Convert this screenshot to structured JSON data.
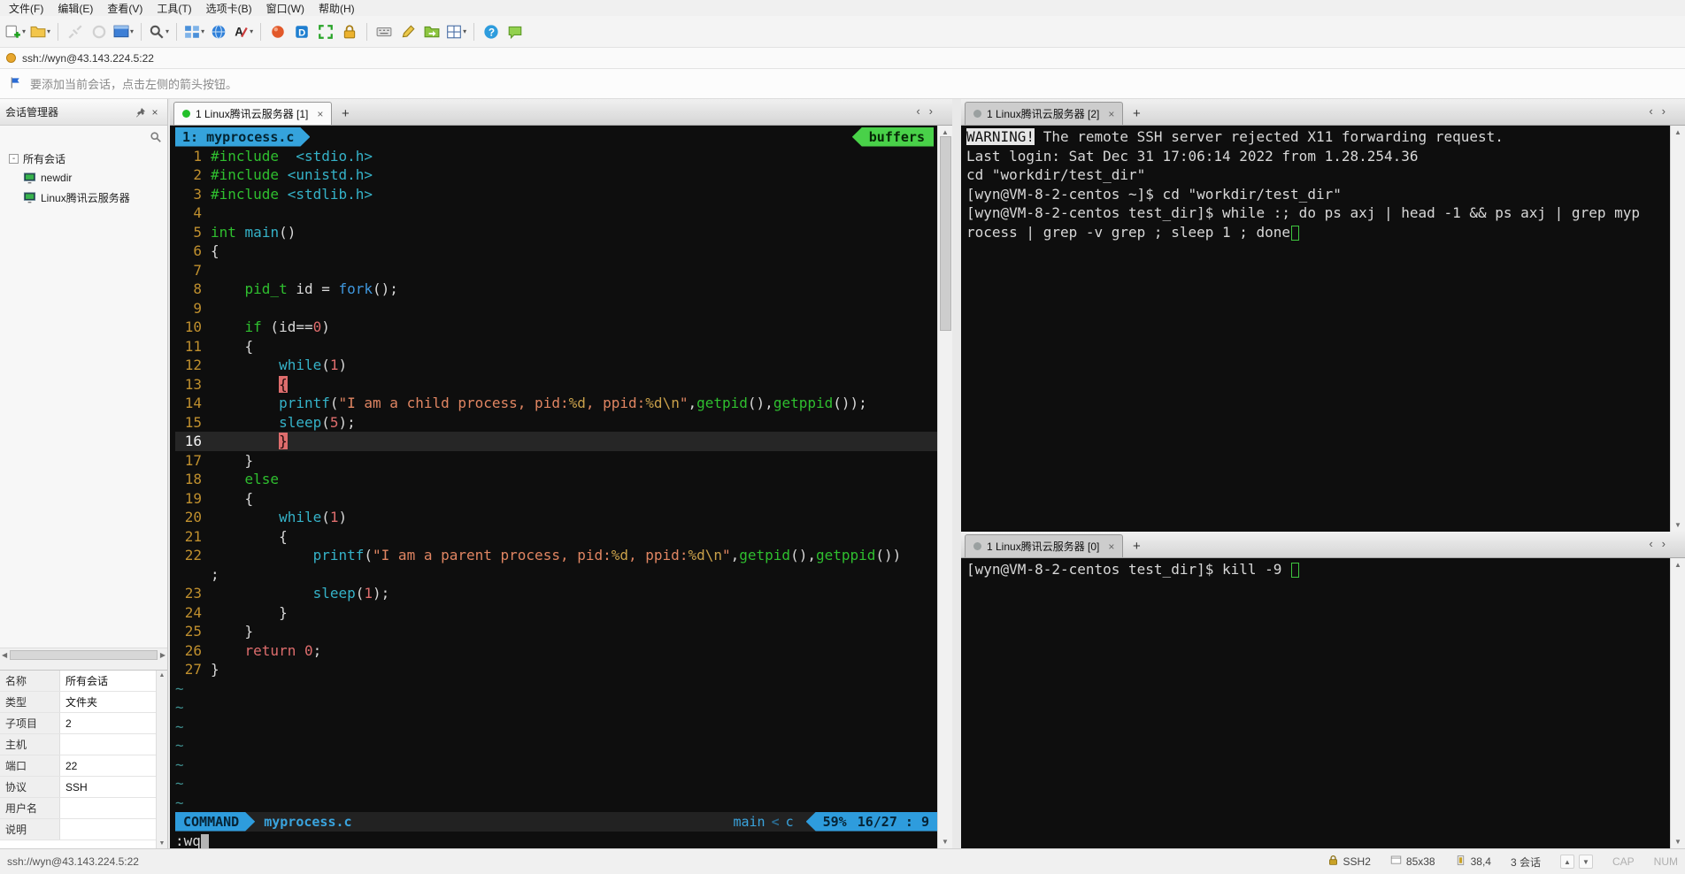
{
  "menu_bar": {
    "items": [
      "文件(F)",
      "编辑(E)",
      "查看(V)",
      "工具(T)",
      "选项卡(B)",
      "窗口(W)",
      "帮助(H)"
    ]
  },
  "toolbar": {
    "items": [
      {
        "icon": "new-session-icon",
        "dropdown": true
      },
      {
        "icon": "open-folder-icon",
        "dropdown": true
      },
      {
        "sep": true
      },
      {
        "icon": "disconnect-icon",
        "disabled": true
      },
      {
        "icon": "reconnect-icon",
        "disabled": true
      },
      {
        "icon": "new-window-icon",
        "dropdown": true
      },
      {
        "sep": true
      },
      {
        "icon": "find-icon",
        "dropdown": true
      },
      {
        "sep": true
      },
      {
        "icon": "layout-icon",
        "dropdown": true
      },
      {
        "icon": "web-icon"
      },
      {
        "icon": "font-color-icon",
        "dropdown": true
      },
      {
        "sep": true
      },
      {
        "icon": "proxy-icon"
      },
      {
        "icon": "xagent-icon"
      },
      {
        "icon": "fullscreen-icon"
      },
      {
        "icon": "lock-icon"
      },
      {
        "sep": true
      },
      {
        "icon": "keyboard-icon"
      },
      {
        "icon": "compose-icon"
      },
      {
        "icon": "xftp-icon"
      },
      {
        "icon": "tile-windows-icon",
        "dropdown": true
      },
      {
        "sep": true
      },
      {
        "icon": "help-icon"
      },
      {
        "icon": "chat-icon"
      }
    ]
  },
  "address_bar": {
    "value": "ssh://wyn@43.143.224.5:22"
  },
  "info_bar": {
    "text": "要添加当前会话，点击左侧的箭头按钮。"
  },
  "session_manager": {
    "title": "会话管理器",
    "tree": [
      {
        "label": "所有会话",
        "type": "folder",
        "level": 0
      },
      {
        "label": "newdir",
        "type": "session",
        "level": 1
      },
      {
        "label": "Linux腾讯云服务器",
        "type": "session",
        "level": 1
      }
    ],
    "properties": [
      {
        "label": "名称",
        "value": "所有会话"
      },
      {
        "label": "类型",
        "value": "文件夹"
      },
      {
        "label": "子项目",
        "value": "2"
      },
      {
        "label": "主机",
        "value": ""
      },
      {
        "label": "端口",
        "value": "22"
      },
      {
        "label": "协议",
        "value": "SSH"
      },
      {
        "label": "用户名",
        "value": ""
      },
      {
        "label": "说明",
        "value": ""
      }
    ]
  },
  "panes": {
    "editor": {
      "tab": {
        "label": "1 Linux腾讯云服务器 [1]",
        "dot_color": "#23c02a"
      },
      "buffer_bar": {
        "left": "1: myprocess.c",
        "right": "buffers"
      },
      "lines": [
        {
          "num": "1",
          "segs": [
            [
              "k",
              "#include"
            ],
            [
              "n",
              "  "
            ],
            [
              "c",
              "<stdio.h>"
            ]
          ]
        },
        {
          "num": "2",
          "segs": [
            [
              "k",
              "#include"
            ],
            [
              "n",
              " "
            ],
            [
              "c",
              "<unistd.h>"
            ]
          ]
        },
        {
          "num": "3",
          "segs": [
            [
              "k",
              "#include"
            ],
            [
              "n",
              " "
            ],
            [
              "c",
              "<stdlib.h>"
            ]
          ]
        },
        {
          "num": "4",
          "segs": []
        },
        {
          "num": "5",
          "segs": [
            [
              "k",
              "int"
            ],
            [
              "n",
              " "
            ],
            [
              "c",
              "main"
            ],
            [
              "n",
              "()"
            ]
          ]
        },
        {
          "num": "6",
          "segs": [
            [
              "n",
              "{"
            ]
          ]
        },
        {
          "num": "7",
          "segs": []
        },
        {
          "num": "8",
          "segs": [
            [
              "n",
              "    "
            ],
            [
              "k",
              "pid_t"
            ],
            [
              "n",
              " id = "
            ],
            [
              "b",
              "fork"
            ],
            [
              "n",
              "();"
            ]
          ]
        },
        {
          "num": "9",
          "segs": []
        },
        {
          "num": "10",
          "segs": [
            [
              "n",
              "    "
            ],
            [
              "k",
              "if"
            ],
            [
              "n",
              " (id=="
            ],
            [
              "r",
              "0"
            ],
            [
              "n",
              ")"
            ]
          ]
        },
        {
          "num": "11",
          "segs": [
            [
              "n",
              "    {"
            ]
          ]
        },
        {
          "num": "12",
          "segs": [
            [
              "n",
              "        "
            ],
            [
              "c",
              "while"
            ],
            [
              "n",
              "("
            ],
            [
              "r",
              "1"
            ],
            [
              "n",
              ")"
            ]
          ]
        },
        {
          "num": "13",
          "segs": [
            [
              "n",
              "        "
            ],
            [
              "mp",
              "{"
            ]
          ]
        },
        {
          "num": "14",
          "segs": [
            [
              "n",
              "        "
            ],
            [
              "c",
              "printf"
            ],
            [
              "n",
              "("
            ],
            [
              "s",
              "\"I am a child process, pid:"
            ],
            [
              "sp",
              "%d"
            ],
            [
              "s",
              ", ppid:"
            ],
            [
              "sp",
              "%d"
            ],
            [
              "sp",
              "\\n"
            ],
            [
              "s",
              "\""
            ],
            [
              "n",
              ","
            ],
            [
              "g",
              "getpid"
            ],
            [
              "n",
              "(),"
            ],
            [
              "g",
              "getppid"
            ],
            [
              "n",
              "());"
            ]
          ]
        },
        {
          "num": "15",
          "segs": [
            [
              "n",
              "        "
            ],
            [
              "c",
              "sleep"
            ],
            [
              "n",
              "("
            ],
            [
              "r",
              "5"
            ],
            [
              "n",
              ");"
            ]
          ]
        },
        {
          "num": "16",
          "cursor_line": true,
          "segs": [
            [
              "n",
              "        "
            ],
            [
              "mp",
              "}"
            ]
          ]
        },
        {
          "num": "17",
          "segs": [
            [
              "n",
              "    }"
            ]
          ]
        },
        {
          "num": "18",
          "segs": [
            [
              "n",
              "    "
            ],
            [
              "k",
              "else"
            ]
          ]
        },
        {
          "num": "19",
          "segs": [
            [
              "n",
              "    {"
            ]
          ]
        },
        {
          "num": "20",
          "segs": [
            [
              "n",
              "        "
            ],
            [
              "c",
              "while"
            ],
            [
              "n",
              "("
            ],
            [
              "r",
              "1"
            ],
            [
              "n",
              ")"
            ]
          ]
        },
        {
          "num": "21",
          "segs": [
            [
              "n",
              "        {"
            ]
          ]
        },
        {
          "num": "22",
          "segs": [
            [
              "n",
              "            "
            ],
            [
              "c",
              "printf"
            ],
            [
              "n",
              "("
            ],
            [
              "s",
              "\"I am a parent process, pid:"
            ],
            [
              "sp",
              "%d"
            ],
            [
              "s",
              ", ppid:"
            ],
            [
              "sp",
              "%d"
            ],
            [
              "sp",
              "\\n"
            ],
            [
              "s",
              "\""
            ],
            [
              "n",
              ","
            ],
            [
              "g",
              "getpid"
            ],
            [
              "n",
              "(),"
            ],
            [
              "g",
              "getppid"
            ],
            [
              "n",
              "())"
            ]
          ]
        },
        {
          "num": "",
          "segs": [
            [
              "n",
              ";"
            ]
          ]
        },
        {
          "num": "23",
          "segs": [
            [
              "n",
              "            "
            ],
            [
              "c",
              "sleep"
            ],
            [
              "n",
              "("
            ],
            [
              "r",
              "1"
            ],
            [
              "n",
              ");"
            ]
          ]
        },
        {
          "num": "24",
          "segs": [
            [
              "n",
              "        }"
            ]
          ]
        },
        {
          "num": "25",
          "segs": [
            [
              "n",
              "    }"
            ]
          ]
        },
        {
          "num": "26",
          "segs": [
            [
              "n",
              "    "
            ],
            [
              "r",
              "return"
            ],
            [
              "n",
              " "
            ],
            [
              "r",
              "0"
            ],
            [
              "n",
              ";"
            ]
          ]
        },
        {
          "num": "27",
          "segs": [
            [
              "n",
              "}"
            ]
          ]
        }
      ],
      "filler": "~",
      "filler_count": 7,
      "statusline": {
        "mode": "COMMAND",
        "file": "myprocess.c",
        "context": "main",
        "separator": "<",
        "filetype": "c",
        "percent": "59%",
        "position": "16/27 :  9"
      },
      "command_line": ":wq"
    },
    "top_right": {
      "tab": {
        "label": "1 Linux腾讯云服务器 [2]",
        "dot_color": "#9aa0a0"
      },
      "lines": [
        {
          "segs": [
            [
              "inv",
              "WARNING!"
            ],
            [
              "t",
              " The remote SSH server rejected X11 forwarding request."
            ]
          ]
        },
        {
          "segs": [
            [
              "t",
              "Last login: Sat Dec 31 17:06:14 2022 from 1.28.254.36"
            ]
          ]
        },
        {
          "segs": [
            [
              "t",
              "cd \"workdir/test_dir\""
            ]
          ]
        },
        {
          "segs": [
            [
              "t",
              "[wyn@VM-8-2-centos ~]$ cd \"workdir/test_dir\""
            ]
          ]
        },
        {
          "segs": [
            [
              "t",
              "[wyn@VM-8-2-centos test_dir]$ while :; do ps axj | head -1 && ps axj | grep myp"
            ]
          ]
        },
        {
          "segs": [
            [
              "t",
              "rocess | grep -v grep ; sleep 1 ; done"
            ],
            [
              "cb",
              " "
            ]
          ]
        }
      ]
    },
    "bottom_right": {
      "tab": {
        "label": "1 Linux腾讯云服务器 [0]",
        "dot_color": "#9aa0a0"
      },
      "lines": [
        {
          "segs": [
            [
              "t",
              "[wyn@VM-8-2-centos test_dir]$ kill -9 "
            ],
            [
              "cb",
              " "
            ]
          ]
        }
      ]
    }
  },
  "status_bar": {
    "left": "ssh://wyn@43.143.224.5:22",
    "protocol": "SSH2",
    "terminal_size": "85x38",
    "cursor_position": "38,4",
    "session_count": "3 会话",
    "caps": "CAP",
    "num": "NUM"
  }
}
